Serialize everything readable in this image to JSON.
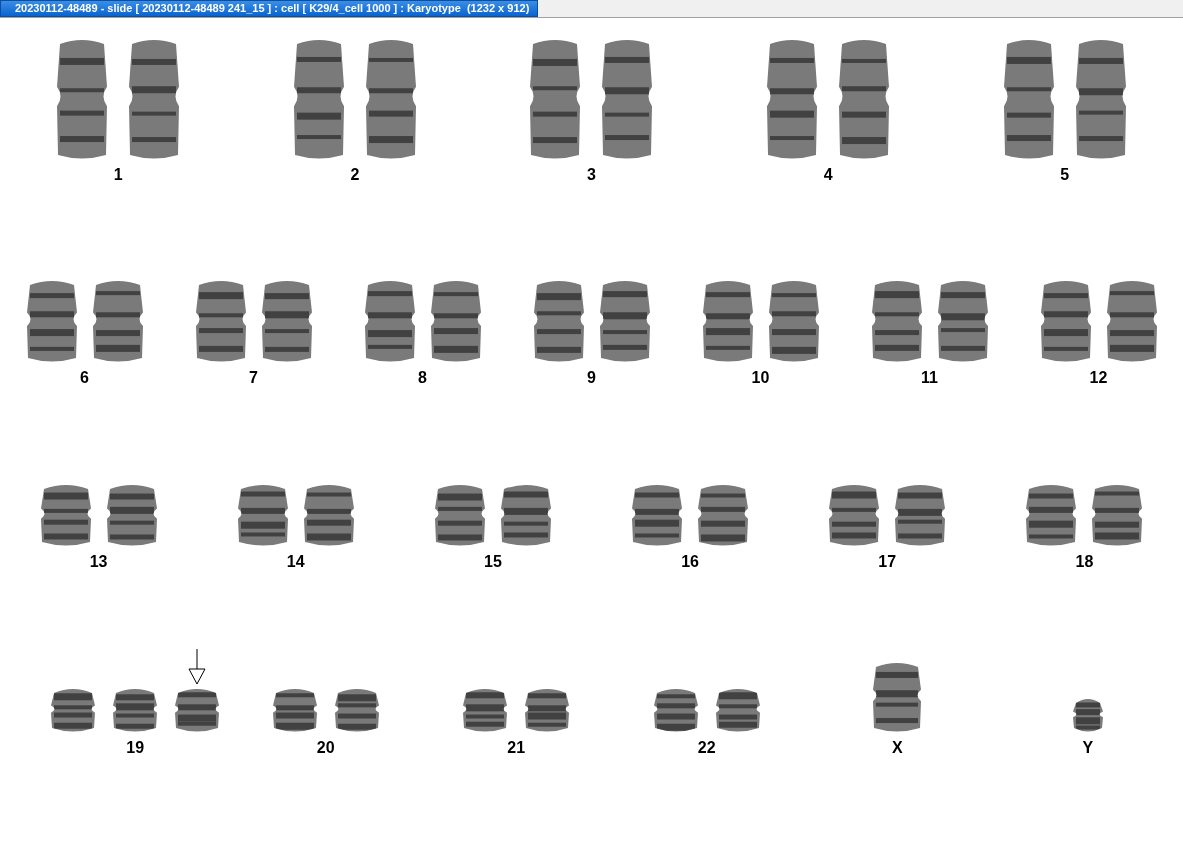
{
  "window": {
    "title": "20230112-48489 - slide [ 20230112-48489 241_15 ] : cell [ K29/4_cell 1000 ] : Karyotype  (1232 x 912)"
  },
  "karyotype": {
    "rows": [
      {
        "groups": [
          {
            "label": "1",
            "chromosomes": [
              {
                "marked": false
              },
              {
                "marked": false
              }
            ]
          },
          {
            "label": "2",
            "chromosomes": [
              {
                "marked": false
              },
              {
                "marked": false
              }
            ]
          },
          {
            "label": "3",
            "chromosomes": [
              {
                "marked": false
              },
              {
                "marked": false
              }
            ]
          },
          {
            "label": "4",
            "chromosomes": [
              {
                "marked": false
              },
              {
                "marked": false
              }
            ]
          },
          {
            "label": "5",
            "chromosomes": [
              {
                "marked": false
              },
              {
                "marked": false
              }
            ]
          }
        ]
      },
      {
        "groups": [
          {
            "label": "6",
            "chromosomes": [
              {
                "marked": false
              },
              {
                "marked": false
              }
            ]
          },
          {
            "label": "7",
            "chromosomes": [
              {
                "marked": false
              },
              {
                "marked": false
              }
            ]
          },
          {
            "label": "8",
            "chromosomes": [
              {
                "marked": false
              },
              {
                "marked": false
              }
            ]
          },
          {
            "label": "9",
            "chromosomes": [
              {
                "marked": false
              },
              {
                "marked": false
              }
            ]
          },
          {
            "label": "10",
            "chromosomes": [
              {
                "marked": false
              },
              {
                "marked": false
              }
            ]
          },
          {
            "label": "11",
            "chromosomes": [
              {
                "marked": false
              },
              {
                "marked": false
              }
            ]
          },
          {
            "label": "12",
            "chromosomes": [
              {
                "marked": false
              },
              {
                "marked": false
              }
            ]
          }
        ]
      },
      {
        "groups": [
          {
            "label": "13",
            "chromosomes": [
              {
                "marked": false
              },
              {
                "marked": false
              }
            ]
          },
          {
            "label": "14",
            "chromosomes": [
              {
                "marked": false
              },
              {
                "marked": false
              }
            ]
          },
          {
            "label": "15",
            "chromosomes": [
              {
                "marked": false
              },
              {
                "marked": false
              }
            ]
          },
          {
            "label": "16",
            "chromosomes": [
              {
                "marked": false
              },
              {
                "marked": false
              }
            ]
          },
          {
            "label": "17",
            "chromosomes": [
              {
                "marked": false
              },
              {
                "marked": false
              }
            ]
          },
          {
            "label": "18",
            "chromosomes": [
              {
                "marked": false
              },
              {
                "marked": false
              }
            ]
          }
        ]
      },
      {
        "groups": [
          {
            "label": "19",
            "chromosomes": [
              {
                "marked": false
              },
              {
                "marked": false
              },
              {
                "marked": true
              }
            ]
          },
          {
            "label": "20",
            "chromosomes": [
              {
                "marked": false
              },
              {
                "marked": false
              }
            ]
          },
          {
            "label": "21",
            "chromosomes": [
              {
                "marked": false
              },
              {
                "marked": false
              }
            ]
          },
          {
            "label": "22",
            "chromosomes": [
              {
                "marked": false
              },
              {
                "marked": false
              }
            ]
          },
          {
            "label": "X",
            "chromosomes": [
              {
                "marked": false
              }
            ]
          },
          {
            "label": "Y",
            "chromosomes": [
              {
                "marked": false
              }
            ]
          }
        ]
      }
    ]
  }
}
